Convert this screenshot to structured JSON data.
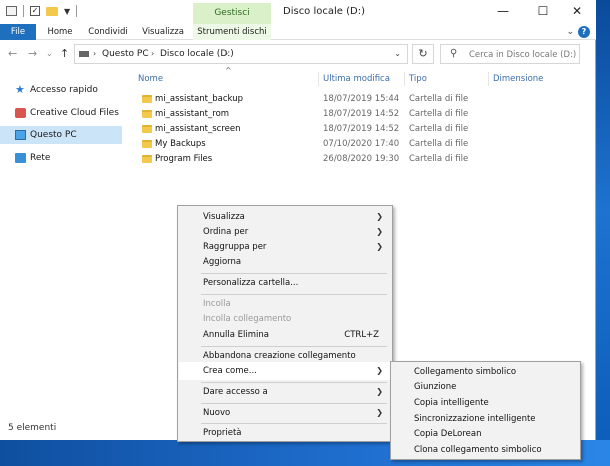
{
  "window": {
    "context_tab": "Gestisci",
    "title": "Disco locale (D:)",
    "minimize": "—",
    "maximize": "☐",
    "close": "✕"
  },
  "ribbon": {
    "tabs": [
      "File",
      "Home",
      "Condividi",
      "Visualizza",
      "Strumenti dischi"
    ],
    "help": "?"
  },
  "address": {
    "crumbs": [
      "Questo PC",
      "Disco locale (D:)"
    ],
    "search_placeholder": "Cerca in Disco locale (D:)"
  },
  "nav": {
    "items": [
      "Accesso rapido",
      "Creative Cloud Files",
      "Questo PC",
      "Rete"
    ],
    "selected": "Questo PC"
  },
  "columns": [
    "Nome",
    "Ultima modifica",
    "Tipo",
    "Dimensione"
  ],
  "files": [
    {
      "name": "mi_assistant_backup",
      "date": "18/07/2019 15:44",
      "type": "Cartella di file"
    },
    {
      "name": "mi_assistant_rom",
      "date": "18/07/2019 14:52",
      "type": "Cartella di file"
    },
    {
      "name": "mi_assistant_screen",
      "date": "18/07/2019 14:52",
      "type": "Cartella di file"
    },
    {
      "name": "My Backups",
      "date": "07/10/2020 17:40",
      "type": "Cartella di file"
    },
    {
      "name": "Program Files",
      "date": "26/08/2020 19:30",
      "type": "Cartella di file"
    }
  ],
  "status": "5 elementi",
  "context_menu": {
    "items": [
      {
        "label": "Visualizza",
        "submenu": true
      },
      {
        "label": "Ordina per",
        "submenu": true
      },
      {
        "label": "Raggruppa per",
        "submenu": true
      },
      {
        "label": "Aggiorna"
      },
      {
        "label": "Personalizza cartella..."
      },
      {
        "label": "Incolla",
        "disabled": true
      },
      {
        "label": "Incolla collegamento",
        "disabled": true
      },
      {
        "label": "Annulla Elimina",
        "shortcut": "CTRL+Z"
      },
      {
        "label": "Abbandona creazione collegamento"
      },
      {
        "label": "Crea come...",
        "submenu": true,
        "highlighted": true
      },
      {
        "label": "Dare accesso a",
        "submenu": true
      },
      {
        "label": "Nuovo",
        "submenu": true
      },
      {
        "label": "Proprietà"
      }
    ]
  },
  "submenu": {
    "items": [
      "Collegamento simbolico",
      "Giunzione",
      "Copia intelligente",
      "Sincronizzazione intelligente",
      "Copia DeLorean",
      "Clona collegamento simbolico"
    ]
  },
  "colors": {
    "file_tab": "#1e6fbe",
    "context_tab": "#d9f0c9",
    "selection": "#cce4f7",
    "folder": "#f2c94c"
  }
}
